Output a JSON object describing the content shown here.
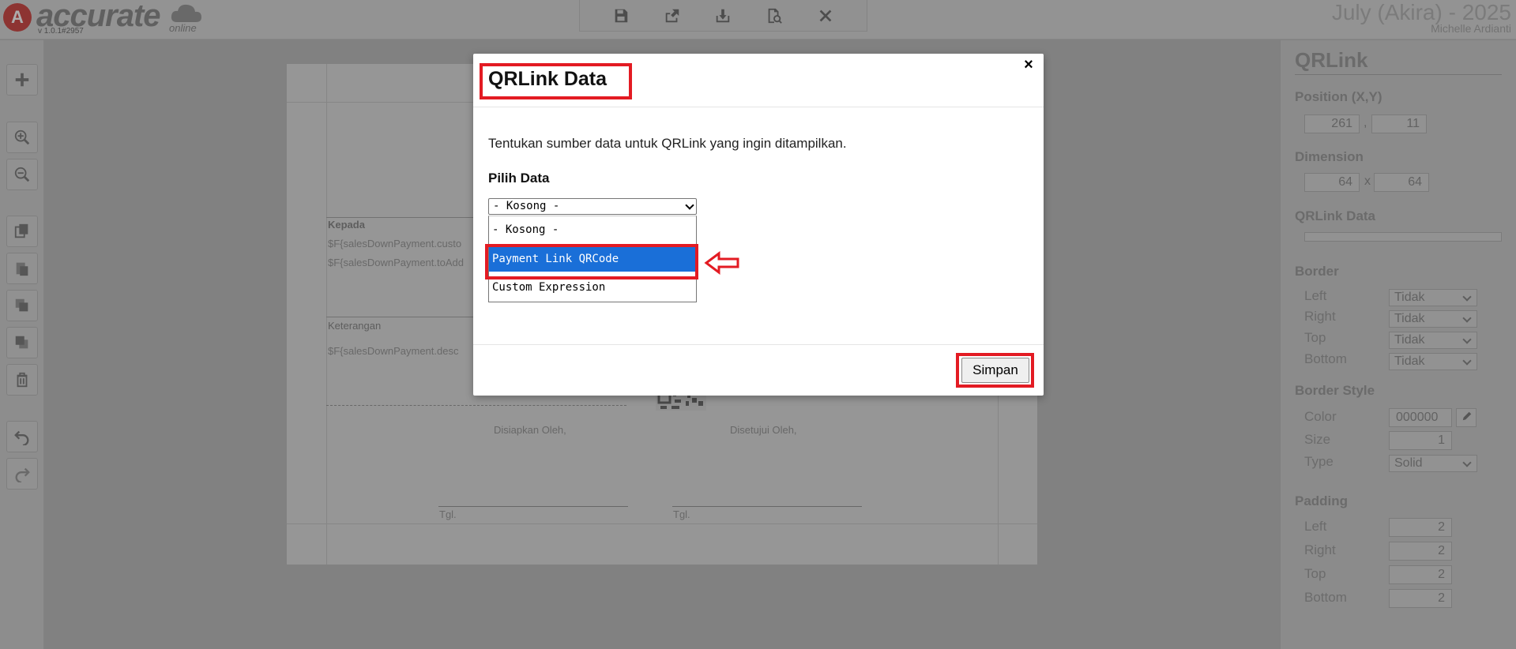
{
  "app": {
    "logo_letter": "A",
    "logo_text": "accurate",
    "logo_sub": "online",
    "version": "v 1.0.1#2957",
    "period": "July (Akira) - 2025",
    "user": "Michelle Ardianti"
  },
  "toolbar": {
    "icons": [
      "save-icon",
      "export-icon",
      "download-icon",
      "preview-icon",
      "close-icon"
    ]
  },
  "left_rail": {
    "icons": [
      "add-icon",
      "zoom-in-icon",
      "zoom-out-icon",
      "copy-icon",
      "paste-icon",
      "bring-front-icon",
      "send-back-icon",
      "delete-icon",
      "undo-icon",
      "redo-icon"
    ]
  },
  "canvas": {
    "kepada_label": "Kepada",
    "field1": "$F{salesDownPayment.custo",
    "field2": "$F{salesDownPayment.toAdd",
    "keterangan_label": "Keterangan",
    "field3": "$F{salesDownPayment.desc",
    "prepared_by": "Disiapkan Oleh,",
    "approved_by": "Disetujui Oleh,",
    "date_left": "Tgl.",
    "date_right": "Tgl."
  },
  "right_panel": {
    "title": "QRLink",
    "position_label": "Position (X,Y)",
    "pos_x": "261",
    "pos_sep": ",",
    "pos_y": "11",
    "dimension_label": "Dimension",
    "dim_w": "64",
    "dim_sep": "x",
    "dim_h": "64",
    "qrlink_data_label": "QRLink Data",
    "border_label": "Border",
    "border_left_label": "Left",
    "border_left_value": "Tidak",
    "border_right_label": "Right",
    "border_right_value": "Tidak",
    "border_top_label": "Top",
    "border_top_value": "Tidak",
    "border_bottom_label": "Bottom",
    "border_bottom_value": "Tidak",
    "border_style_label": "Border Style",
    "color_label": "Color",
    "color_value": "000000",
    "size_label": "Size",
    "size_value": "1",
    "type_label": "Type",
    "type_value": "Solid",
    "padding_label": "Padding",
    "pad_left_label": "Left",
    "pad_left_value": "2",
    "pad_right_label": "Right",
    "pad_right_value": "2",
    "pad_top_label": "Top",
    "pad_top_value": "2",
    "pad_bottom_label": "Bottom",
    "pad_bottom_value": "2"
  },
  "modal": {
    "title": "QRLink Data",
    "close_label": "×",
    "description": "Tentukan sumber data untuk QRLink yang ingin ditampilkan.",
    "field_label": "Pilih Data",
    "selected_value": "- Kosong -",
    "options": [
      "- Kosong -",
      "Payment Link QRCode",
      "Custom Expression"
    ],
    "highlighted_option": "Payment Link QRCode",
    "save_label": "Simpan"
  },
  "colors": {
    "highlight": "#e31b23",
    "selection": "#1a6fd8"
  }
}
